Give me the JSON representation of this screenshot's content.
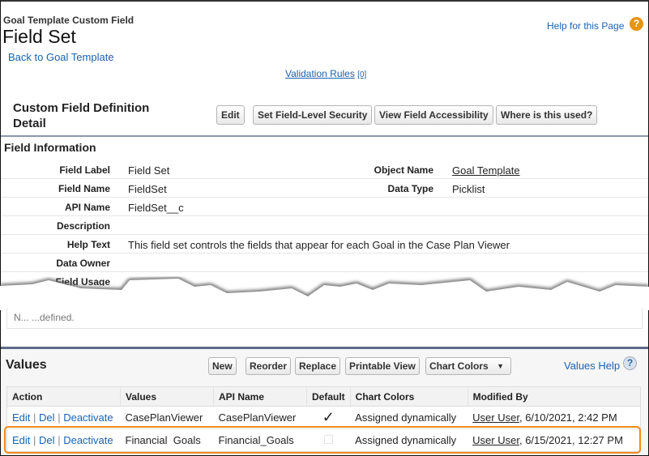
{
  "header": {
    "breadcrumb": "Goal Template Custom Field",
    "title": "Field Set",
    "back_link": "Back to Goal Template",
    "help_link": "Help for this Page",
    "help_icon": "?",
    "validation_rules": "Validation Rules",
    "validation_count": "[0]"
  },
  "detail": {
    "title": "Custom Field Definition Detail",
    "buttons": {
      "edit": "Edit",
      "fls": "Set Field-Level Security",
      "access": "View Field Accessibility",
      "where": "Where is this used?"
    }
  },
  "field_info": {
    "title": "Field Information",
    "rows": [
      {
        "label": "Field Label",
        "value": "Field Set",
        "label2": "Object Name",
        "value2": "Goal Template"
      },
      {
        "label": "Field Name",
        "value": "FieldSet",
        "label2": "Data Type",
        "value2": "Picklist"
      },
      {
        "label": "API Name",
        "value": "FieldSet__c"
      },
      {
        "label": "Description",
        "value": ""
      },
      {
        "label": "Help Text",
        "value": "This field set controls the fields that appear for each Goal in the Case Plan Viewer"
      },
      {
        "label": "Data Owner",
        "value": ""
      },
      {
        "label": "Field Usage",
        "value": ""
      }
    ],
    "partial_text": "N...  ...defined."
  },
  "values": {
    "title": "Values",
    "buttons": {
      "new": "New",
      "reorder": "Reorder",
      "replace": "Replace",
      "printable": "Printable View",
      "chart_colors": "Chart Colors"
    },
    "help": "Values Help",
    "help_icon": "?",
    "columns": [
      "Action",
      "Values",
      "API Name",
      "Default",
      "Chart Colors",
      "Modified By"
    ],
    "actions": {
      "edit": "Edit",
      "del": "Del",
      "deactivate": "Deactivate",
      "sep": "|"
    },
    "rows": [
      {
        "value": "CasePlanViewer",
        "api": "CasePlanViewer",
        "default": "✓",
        "colors": "Assigned dynamically",
        "user": "User User",
        "date": ", 6/10/2021, 2:42 PM"
      },
      {
        "value": "Financial  Goals",
        "api": "Financial_Goals",
        "default": "",
        "colors": "Assigned dynamically",
        "user": "User User",
        "date": ", 6/15/2021, 12:27 PM"
      }
    ]
  }
}
